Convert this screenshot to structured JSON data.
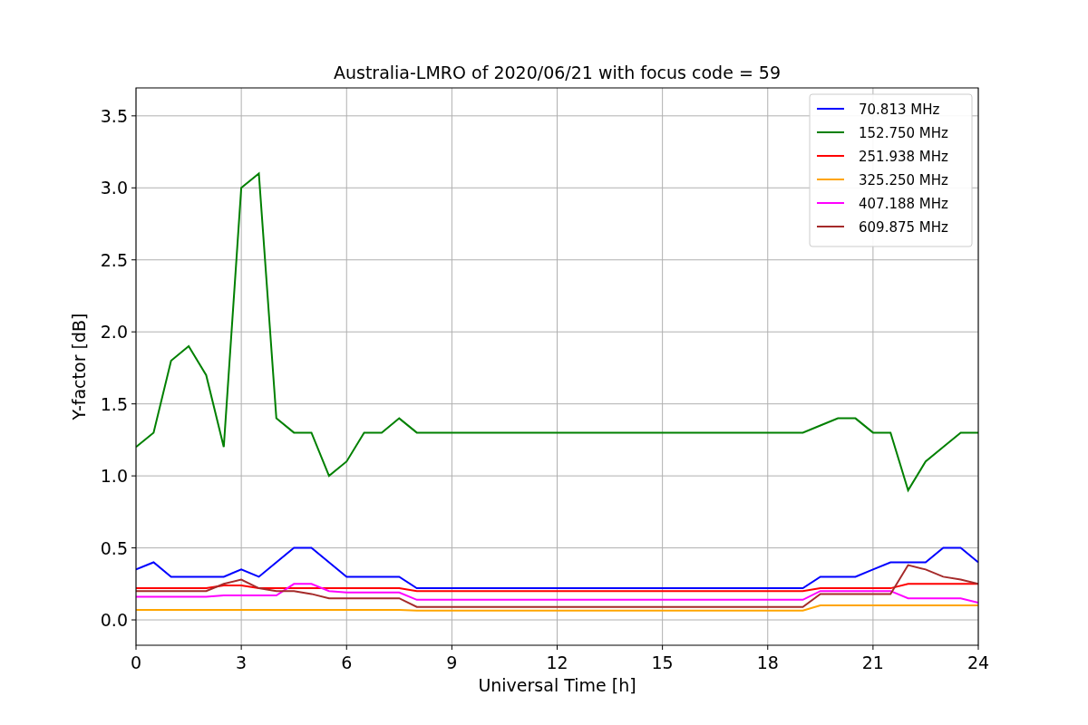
{
  "figure": {
    "chart_data": {
      "type": "line",
      "title": "Australia-LMRO of 2020/06/21 with focus code = 59",
      "xlabel": "Universal Time [h]",
      "ylabel": "Y-factor [dB]",
      "x": [
        0,
        0.5,
        1,
        1.5,
        2,
        2.5,
        3,
        3.5,
        4,
        4.5,
        5,
        5.5,
        6,
        6.5,
        7,
        7.5,
        8,
        8.5,
        9,
        9.5,
        10,
        10.5,
        11,
        11.5,
        12,
        12.5,
        13,
        13.5,
        14,
        14.5,
        15,
        15.5,
        16,
        16.5,
        17,
        17.5,
        18,
        18.5,
        19,
        19.5,
        20,
        20.5,
        21,
        21.5,
        22,
        22.5,
        23,
        23.5,
        24
      ],
      "series": [
        {
          "name": "70.813 MHz",
          "color": "#0000ff",
          "values": [
            0.35,
            0.4,
            0.3,
            0.3,
            0.3,
            0.3,
            0.35,
            0.3,
            0.4,
            0.5,
            0.5,
            0.4,
            0.3,
            0.3,
            0.3,
            0.3,
            0.22,
            0.22,
            0.22,
            0.22,
            0.22,
            0.22,
            0.22,
            0.22,
            0.22,
            0.22,
            0.22,
            0.22,
            0.22,
            0.22,
            0.22,
            0.22,
            0.22,
            0.22,
            0.22,
            0.22,
            0.22,
            0.22,
            0.22,
            0.3,
            0.3,
            0.3,
            0.35,
            0.4,
            0.4,
            0.4,
            0.5,
            0.5,
            0.4
          ]
        },
        {
          "name": "152.750 MHz",
          "color": "#008000",
          "values": [
            1.2,
            1.3,
            1.8,
            1.9,
            1.7,
            1.2,
            3.0,
            3.1,
            1.4,
            1.3,
            1.3,
            1.0,
            1.1,
            1.3,
            1.3,
            1.4,
            1.3,
            1.3,
            1.3,
            1.3,
            1.3,
            1.3,
            1.3,
            1.3,
            1.3,
            1.3,
            1.3,
            1.3,
            1.3,
            1.3,
            1.3,
            1.3,
            1.3,
            1.3,
            1.3,
            1.3,
            1.3,
            1.3,
            1.3,
            1.35,
            1.4,
            1.4,
            1.3,
            1.3,
            0.9,
            1.1,
            1.2,
            1.3,
            1.3
          ]
        },
        {
          "name": "251.938 MHz",
          "color": "#ff0000",
          "values": [
            0.22,
            0.22,
            0.22,
            0.22,
            0.22,
            0.24,
            0.24,
            0.22,
            0.22,
            0.22,
            0.22,
            0.22,
            0.22,
            0.22,
            0.22,
            0.22,
            0.2,
            0.2,
            0.2,
            0.2,
            0.2,
            0.2,
            0.2,
            0.2,
            0.2,
            0.2,
            0.2,
            0.2,
            0.2,
            0.2,
            0.2,
            0.2,
            0.2,
            0.2,
            0.2,
            0.2,
            0.2,
            0.2,
            0.2,
            0.22,
            0.22,
            0.22,
            0.22,
            0.22,
            0.25,
            0.25,
            0.25,
            0.25,
            0.25
          ]
        },
        {
          "name": "325.250 MHz",
          "color": "#ffa500",
          "values": [
            0.07,
            0.07,
            0.07,
            0.07,
            0.07,
            0.07,
            0.07,
            0.07,
            0.07,
            0.07,
            0.07,
            0.07,
            0.07,
            0.07,
            0.07,
            0.07,
            0.065,
            0.065,
            0.065,
            0.065,
            0.065,
            0.065,
            0.065,
            0.065,
            0.065,
            0.065,
            0.065,
            0.065,
            0.065,
            0.065,
            0.065,
            0.065,
            0.065,
            0.065,
            0.065,
            0.065,
            0.065,
            0.065,
            0.065,
            0.1,
            0.1,
            0.1,
            0.1,
            0.1,
            0.1,
            0.1,
            0.1,
            0.1,
            0.1
          ]
        },
        {
          "name": "407.188 MHz",
          "color": "#ff00ff",
          "values": [
            0.16,
            0.16,
            0.16,
            0.16,
            0.16,
            0.17,
            0.17,
            0.17,
            0.17,
            0.25,
            0.25,
            0.2,
            0.19,
            0.19,
            0.19,
            0.19,
            0.14,
            0.14,
            0.14,
            0.14,
            0.14,
            0.14,
            0.14,
            0.14,
            0.14,
            0.14,
            0.14,
            0.14,
            0.14,
            0.14,
            0.14,
            0.14,
            0.14,
            0.14,
            0.14,
            0.14,
            0.14,
            0.14,
            0.14,
            0.2,
            0.2,
            0.2,
            0.2,
            0.2,
            0.15,
            0.15,
            0.15,
            0.15,
            0.12
          ]
        },
        {
          "name": "609.875 MHz",
          "color": "#a52a2a",
          "values": [
            0.2,
            0.2,
            0.2,
            0.2,
            0.2,
            0.25,
            0.28,
            0.22,
            0.2,
            0.2,
            0.18,
            0.15,
            0.15,
            0.15,
            0.15,
            0.15,
            0.09,
            0.09,
            0.09,
            0.09,
            0.09,
            0.09,
            0.09,
            0.09,
            0.09,
            0.09,
            0.09,
            0.09,
            0.09,
            0.09,
            0.09,
            0.09,
            0.09,
            0.09,
            0.09,
            0.09,
            0.09,
            0.09,
            0.09,
            0.18,
            0.18,
            0.18,
            0.18,
            0.18,
            0.38,
            0.35,
            0.3,
            0.28,
            0.25
          ]
        }
      ],
      "grid": true,
      "legend": true,
      "xlim": [
        0,
        24
      ],
      "ylim": [
        -0.176,
        3.694
      ],
      "xticks": [
        0,
        3,
        6,
        9,
        12,
        15,
        18,
        21,
        24
      ],
      "yticks": [
        {
          "value": 0,
          "label": "0.0"
        },
        {
          "value": 0.5,
          "label": "0.5"
        },
        {
          "value": 1,
          "label": "1.0"
        },
        {
          "value": 1.5,
          "label": "1.5"
        },
        {
          "value": 2,
          "label": "2.0"
        },
        {
          "value": 2.5,
          "label": "2.5"
        },
        {
          "value": 3,
          "label": "3.0"
        },
        {
          "value": 3.5,
          "label": "3.5"
        }
      ]
    }
  }
}
